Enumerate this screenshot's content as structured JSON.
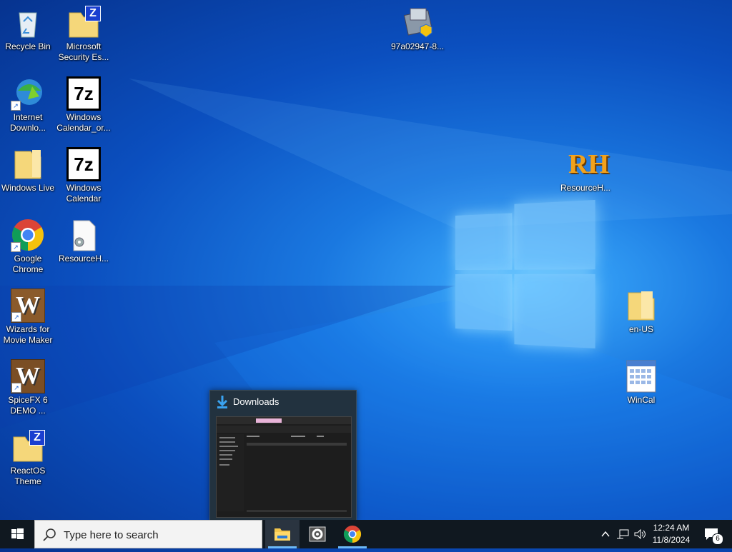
{
  "desktop": {
    "icons": [
      {
        "label": "Recycle Bin"
      },
      {
        "label": "Microsoft Security Es..."
      },
      {
        "label": "Internet Downlo..."
      },
      {
        "label": "Windows Calendar_or..."
      },
      {
        "label": "Windows Live"
      },
      {
        "label": "Windows Calendar"
      },
      {
        "label": "Google Chrome"
      },
      {
        "label": "ResourceH..."
      },
      {
        "label": "Wizards for Movie Maker"
      },
      {
        "label": "SpiceFX 6 DEMO ..."
      },
      {
        "label": "ReactOS Theme"
      },
      {
        "label": "97a02947-8..."
      },
      {
        "label": "ResourceH..."
      },
      {
        "label": "en-US"
      },
      {
        "label": "WinCal"
      }
    ],
    "glyphs": {
      "sevenzip": "7z",
      "rh": "RH",
      "wizards": "W",
      "z": "Z",
      "arrow": "↗"
    }
  },
  "preview": {
    "title": "Downloads"
  },
  "taskbar": {
    "search_placeholder": "Type here to search",
    "apps": [
      {
        "name": "File Explorer",
        "icon": "folder-icon",
        "active": true
      },
      {
        "name": "Settings",
        "icon": "gear-icon"
      },
      {
        "name": "Google Chrome",
        "icon": "chrome-icon"
      }
    ],
    "time": "12:24 AM",
    "date": "11/8/2024",
    "notification_count": "6"
  },
  "colors": {
    "accent": "#6cb8f6",
    "taskbar": "#101820"
  }
}
